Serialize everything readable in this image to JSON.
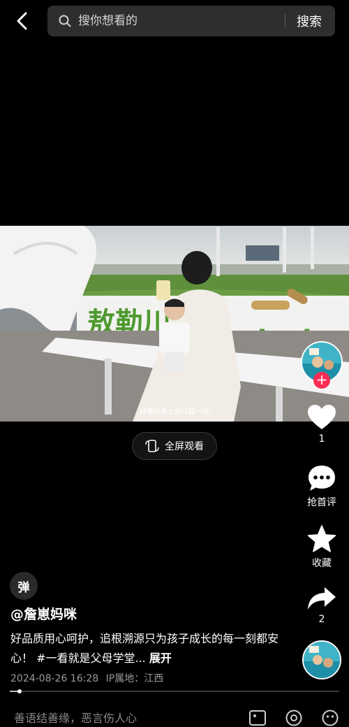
{
  "header": {
    "search_placeholder": "搜你想看的",
    "search_button": "搜索"
  },
  "video": {
    "caption": "就像你要上幼儿园一样"
  },
  "fullscreen": {
    "label": "全屏观看"
  },
  "actions": {
    "like_count": "1",
    "comment_label": "抢首评",
    "favorite_label": "收藏",
    "share_count": "2"
  },
  "info": {
    "danmu_label": "弹",
    "author": "@詹崽妈咪",
    "description": "好品质用心呵护，追根溯源只为孩子成长的每一刻都安心！ #一看就是父母学堂...",
    "expand": "展开",
    "date": "2024-08-26 16:28",
    "location": "IP属地：江西",
    "progress": 0.03
  },
  "comment_bar": {
    "placeholder": "善语结善缘，恶言伤人心"
  },
  "colors": {
    "accent_red": "#fe2c55",
    "background": "#000000"
  }
}
